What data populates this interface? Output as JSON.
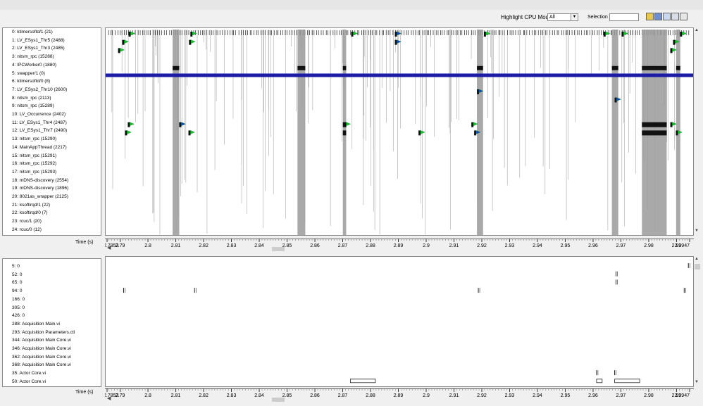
{
  "toolbar": {
    "highlight_label": "Highlight CPU Mode:",
    "highlight_value": "All",
    "selection_label": "Selection",
    "selection_value": "",
    "icons": [
      "folder-icon",
      "save-icon",
      "zoom-icon",
      "export-icon",
      "settings-icon"
    ]
  },
  "threads_panel": {
    "rows": [
      "0: ktimersoftd/1 (21)",
      "1: LV_ESys1_Thr5 (2488)",
      "2: LV_ESys1_Thr3 (2485)",
      "3: nitsm_rpc (15288)",
      "4: IPCWorker0 (1880)",
      "5: swapper/1 (0)",
      "6: ktimersoftd/0 (8)",
      "7: LV_ESys2_Thr10 (2600)",
      "8: nitsm_rpc (2113)",
      "9: nitsm_rpc (15289)",
      "10: LV_Occurrence (2402)",
      "11: LV_ESys1_Thr4 (2487)",
      "12: LV_ESys1_Thr7 (2490)",
      "13: nitsm_rpc (15290)",
      "14: MainAppThread (2217)",
      "15: nitsm_rpc (15291)",
      "16: nitsm_rpc (15292)",
      "17: nitsm_rpc (15293)",
      "18: mDNS-discovery (2554)",
      "19: mDNS-discovery (1896)",
      "20: 8021as_wrapper (2125)",
      "21: ksoftirqd/1 (22)",
      "22: ksoftirqd/0 (7)",
      "23: rcuc/1 (20)",
      "24: rcuc/0 (12)"
    ]
  },
  "events_panel": {
    "rows": [
      "5: 0",
      "52: 0",
      "65: 0",
      "94: 0",
      "166: 0",
      "305: 0",
      "426: 0",
      "288: Acquisition Main.vi",
      "293: Acquisition Parameters.ctl",
      "344: Acquisition Main Core.vi",
      "346: Acquisition Main Core.vi",
      "362: Acquisition Main Core.vi",
      "368: Acquisition Main Core.vi",
      "35: Actor Core.vi",
      "50: Actor Core.vi"
    ]
  },
  "axis": {
    "title": "Time (s)",
    "start_label": "2.7853",
    "end_label": "2.9947",
    "tick_labels": [
      "2.79",
      "2.8",
      "2.81",
      "2.82",
      "2.83",
      "2.84",
      "2.85",
      "2.86",
      "2.87",
      "2.88",
      "2.89",
      "2.9",
      "2.91",
      "2.92",
      "2.93",
      "2.94",
      "2.95",
      "2.96",
      "2.97",
      "2.98",
      "2.99"
    ],
    "tick_values": [
      2.79,
      2.8,
      2.81,
      2.82,
      2.83,
      2.84,
      2.85,
      2.86,
      2.87,
      2.88,
      2.89,
      2.9,
      2.91,
      2.92,
      2.93,
      2.94,
      2.95,
      2.96,
      2.97,
      2.98,
      2.99
    ],
    "range": [
      2.7853,
      2.9947
    ]
  },
  "chart_data": {
    "type": "timeline",
    "x_range": [
      2.7853,
      2.9947
    ],
    "busy_regions": [
      [
        2.8086,
        2.811
      ],
      [
        2.8535,
        2.8563
      ],
      [
        2.8698,
        2.871
      ],
      [
        2.918,
        2.9202
      ],
      [
        2.9665,
        2.9688
      ],
      [
        2.9773,
        2.9862
      ],
      [
        2.9896,
        2.9911
      ]
    ],
    "swapper_row": 5,
    "event_marks": [
      {
        "row": 0,
        "t": 2.7933
      },
      {
        "row": 0,
        "t": 2.8155
      },
      {
        "row": 0,
        "t": 2.8733
      },
      {
        "row": 0,
        "t": 2.889
      },
      {
        "row": 0,
        "t": 2.921
      },
      {
        "row": 0,
        "t": 2.964
      },
      {
        "row": 0,
        "t": 2.9705
      },
      {
        "row": 0,
        "t": 2.9915
      },
      {
        "row": 1,
        "t": 2.791
      },
      {
        "row": 1,
        "t": 2.815
      },
      {
        "row": 1,
        "t": 2.889
      },
      {
        "row": 1,
        "t": 2.989
      },
      {
        "row": 2,
        "t": 2.7895
      },
      {
        "row": 2,
        "t": 2.988
      },
      {
        "row": 7,
        "t": 2.9185
      },
      {
        "row": 8,
        "t": 2.968
      },
      {
        "row": 11,
        "t": 2.793
      },
      {
        "row": 11,
        "t": 2.8115
      },
      {
        "row": 11,
        "t": 2.8708
      },
      {
        "row": 11,
        "t": 2.9165
      },
      {
        "row": 11,
        "t": 2.988
      },
      {
        "row": 12,
        "t": 2.792
      },
      {
        "row": 12,
        "t": 2.8148
      },
      {
        "row": 12,
        "t": 2.8975
      },
      {
        "row": 12,
        "t": 2.9175
      },
      {
        "row": 12,
        "t": 2.99
      }
    ],
    "lower_marks": [
      {
        "row": 0,
        "t": 2.994
      },
      {
        "row": 1,
        "t": 2.968
      },
      {
        "row": 2,
        "t": 2.968
      },
      {
        "row": 3,
        "t": 2.791
      },
      {
        "row": 3,
        "t": 2.8165
      },
      {
        "row": 3,
        "t": 2.9185
      },
      {
        "row": 3,
        "t": 2.9925
      },
      {
        "row": 13,
        "t": 2.961
      },
      {
        "row": 13,
        "t": 2.9675
      }
    ],
    "lower_spans": [
      {
        "row": 14,
        "start": 2.8725,
        "end": 2.8815
      },
      {
        "row": 14,
        "start": 2.961,
        "end": 2.963
      },
      {
        "row": 14,
        "start": 2.9675,
        "end": 2.9765
      }
    ]
  }
}
